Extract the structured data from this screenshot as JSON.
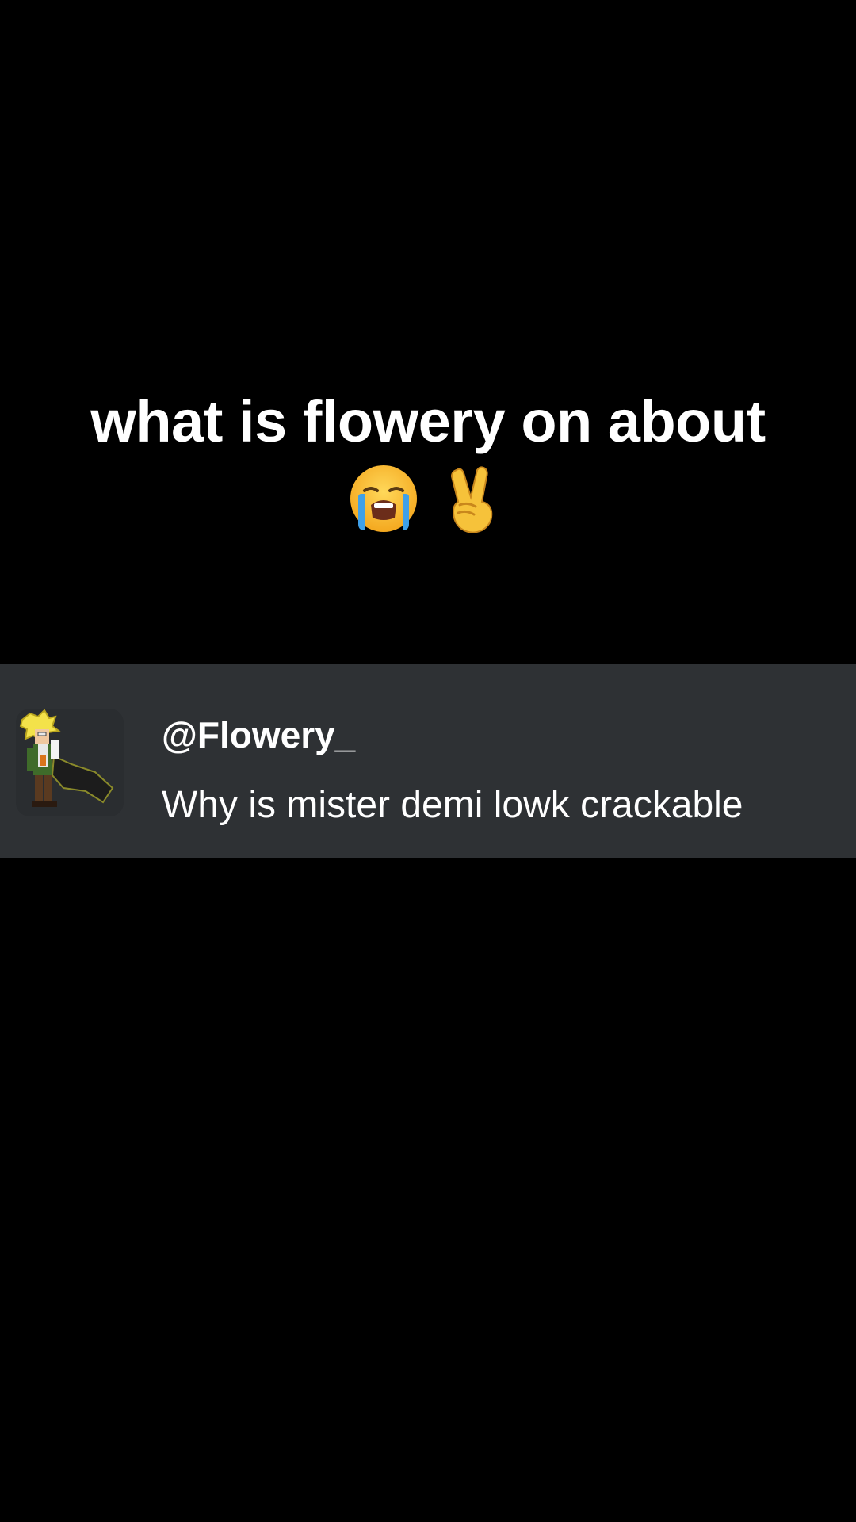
{
  "caption": {
    "line1": "what is flowery on about",
    "emojis": [
      "loudly-crying-face-icon",
      "victory-hand-icon"
    ]
  },
  "comment": {
    "username": "@Flowery_",
    "text": "Why is mister demi lowk crackable",
    "avatar": "pixel-character-avatar"
  },
  "colors": {
    "background": "#000000",
    "comment_bar": "#2e3134",
    "text": "#ffffff"
  }
}
